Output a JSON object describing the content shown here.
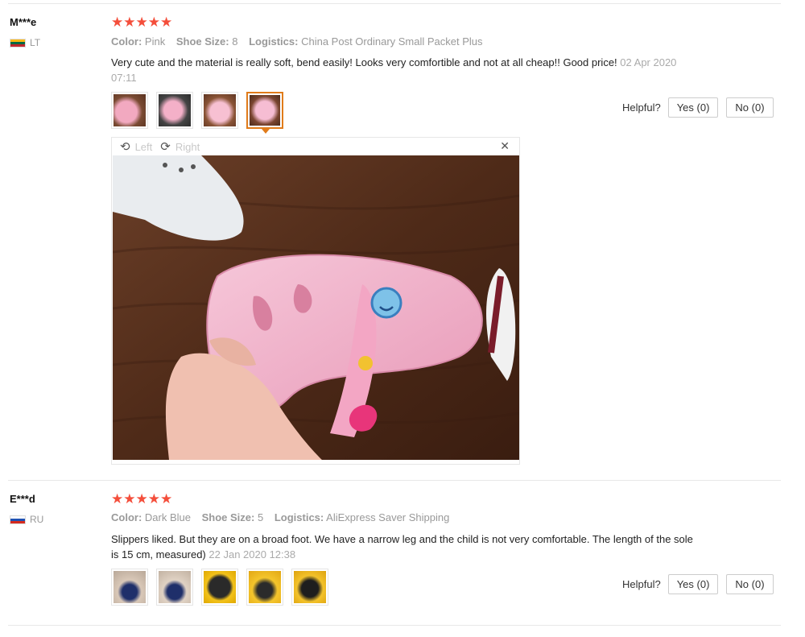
{
  "reviews": [
    {
      "user": "M***e",
      "country": "LT",
      "stars": "★★★★★",
      "color_key": "Color:",
      "color_val": "Pink",
      "size_key": "Shoe Size:",
      "size_val": "8",
      "logistics_key": "Logistics:",
      "logistics_val": "China Post Ordinary Small Packet Plus",
      "text": "Very cute and the material is really soft, bend easily! Looks very comfortible and not at all cheap!! Good price!",
      "date": "02 Apr 2020 07:11",
      "helpful_label": "Helpful?",
      "yes_label": "Yes (0)",
      "no_label": "No (0)"
    },
    {
      "user": "E***d",
      "country": "RU",
      "stars": "★★★★★",
      "color_key": "Color:",
      "color_val": "Dark Blue",
      "size_key": "Shoe Size:",
      "size_val": "5",
      "logistics_key": "Logistics:",
      "logistics_val": "AliExpress Saver Shipping",
      "text": "Slippers liked. But they are on a broad foot. We have a narrow leg and the child is not very comfortable. The length of the sole is 15 cm, measured)",
      "date": "22 Jan 2020 12:38",
      "helpful_label": "Helpful?",
      "yes_label": "Yes (0)",
      "no_label": "No (0)"
    }
  ],
  "viewer": {
    "left_label": "Left",
    "right_label": "Right",
    "left_icon": "rotate-left-icon",
    "right_icon": "rotate-right-icon",
    "close_icon": "close-icon"
  },
  "colors": {
    "star": "#f44e3b",
    "active_thumb_border": "#e07b1a"
  }
}
